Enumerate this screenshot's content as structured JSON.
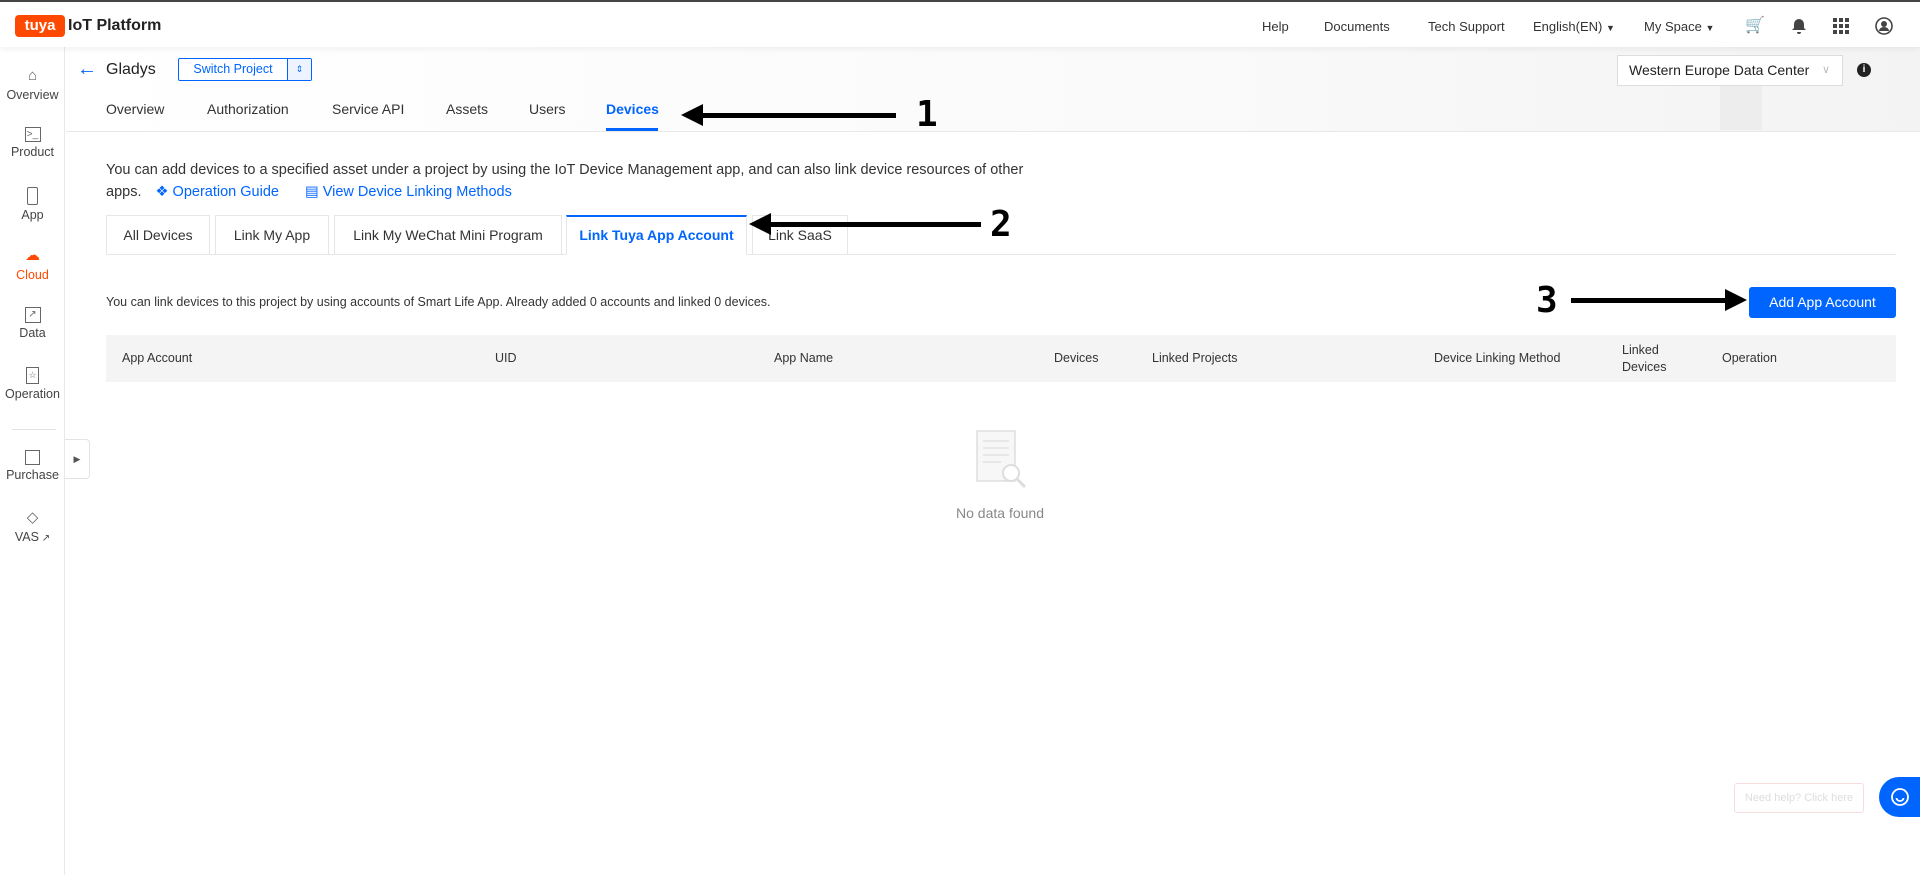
{
  "topbar": {
    "logo": "tuya",
    "title": "IoT Platform",
    "links": [
      "Help",
      "Documents",
      "Tech Support"
    ],
    "language": "English(EN)",
    "space": "My Space",
    "icons": [
      "cart-icon",
      "bell-icon",
      "apps-grid-icon",
      "user-avatar-icon"
    ]
  },
  "sidebar": {
    "items": [
      {
        "label": "Overview",
        "icon": "home-icon"
      },
      {
        "label": "Product",
        "icon": "terminal-icon"
      },
      {
        "label": "App",
        "icon": "phone-icon"
      },
      {
        "label": "Cloud",
        "icon": "cloud-icon",
        "active": true
      },
      {
        "label": "Data",
        "icon": "chart-icon"
      },
      {
        "label": "Operation",
        "icon": "bookmark-star-icon"
      },
      {
        "label": "Purchase",
        "icon": "box-icon"
      },
      {
        "label": "VAS",
        "icon": "diamond-icon"
      }
    ]
  },
  "project": {
    "name": "Gladys",
    "switch_label": "Switch Project",
    "data_center": "Western Europe Data Center"
  },
  "tabs": [
    "Overview",
    "Authorization",
    "Service API",
    "Assets",
    "Users",
    "Devices"
  ],
  "active_tab": "Devices",
  "description": {
    "line1": "You can add devices to a specified asset under a project by using the IoT Device Management app, and can also link device resources of other",
    "line2": "apps.",
    "link_guide": "Operation Guide",
    "link_methods": "View Device Linking Methods"
  },
  "subtabs": [
    "All Devices",
    "Link My App",
    "Link My WeChat Mini Program",
    "Link Tuya App Account",
    "Link SaaS"
  ],
  "active_subtab": "Link Tuya App Account",
  "info_text": "You can link devices to this project by using accounts of Smart Life App. Already added 0 accounts and linked 0 devices.",
  "add_button": "Add App Account",
  "table": {
    "columns": [
      "App Account",
      "UID",
      "App Name",
      "Devices",
      "Linked Projects",
      "Device Linking Method",
      "Linked\nDevices",
      "Operation"
    ],
    "rows": [],
    "empty_text": "No data found"
  },
  "annotations": [
    "1",
    "2",
    "3"
  ],
  "help": {
    "label": "Need help? Click here"
  },
  "colors": {
    "brand": "#ff4800",
    "accent": "#0065ff"
  }
}
